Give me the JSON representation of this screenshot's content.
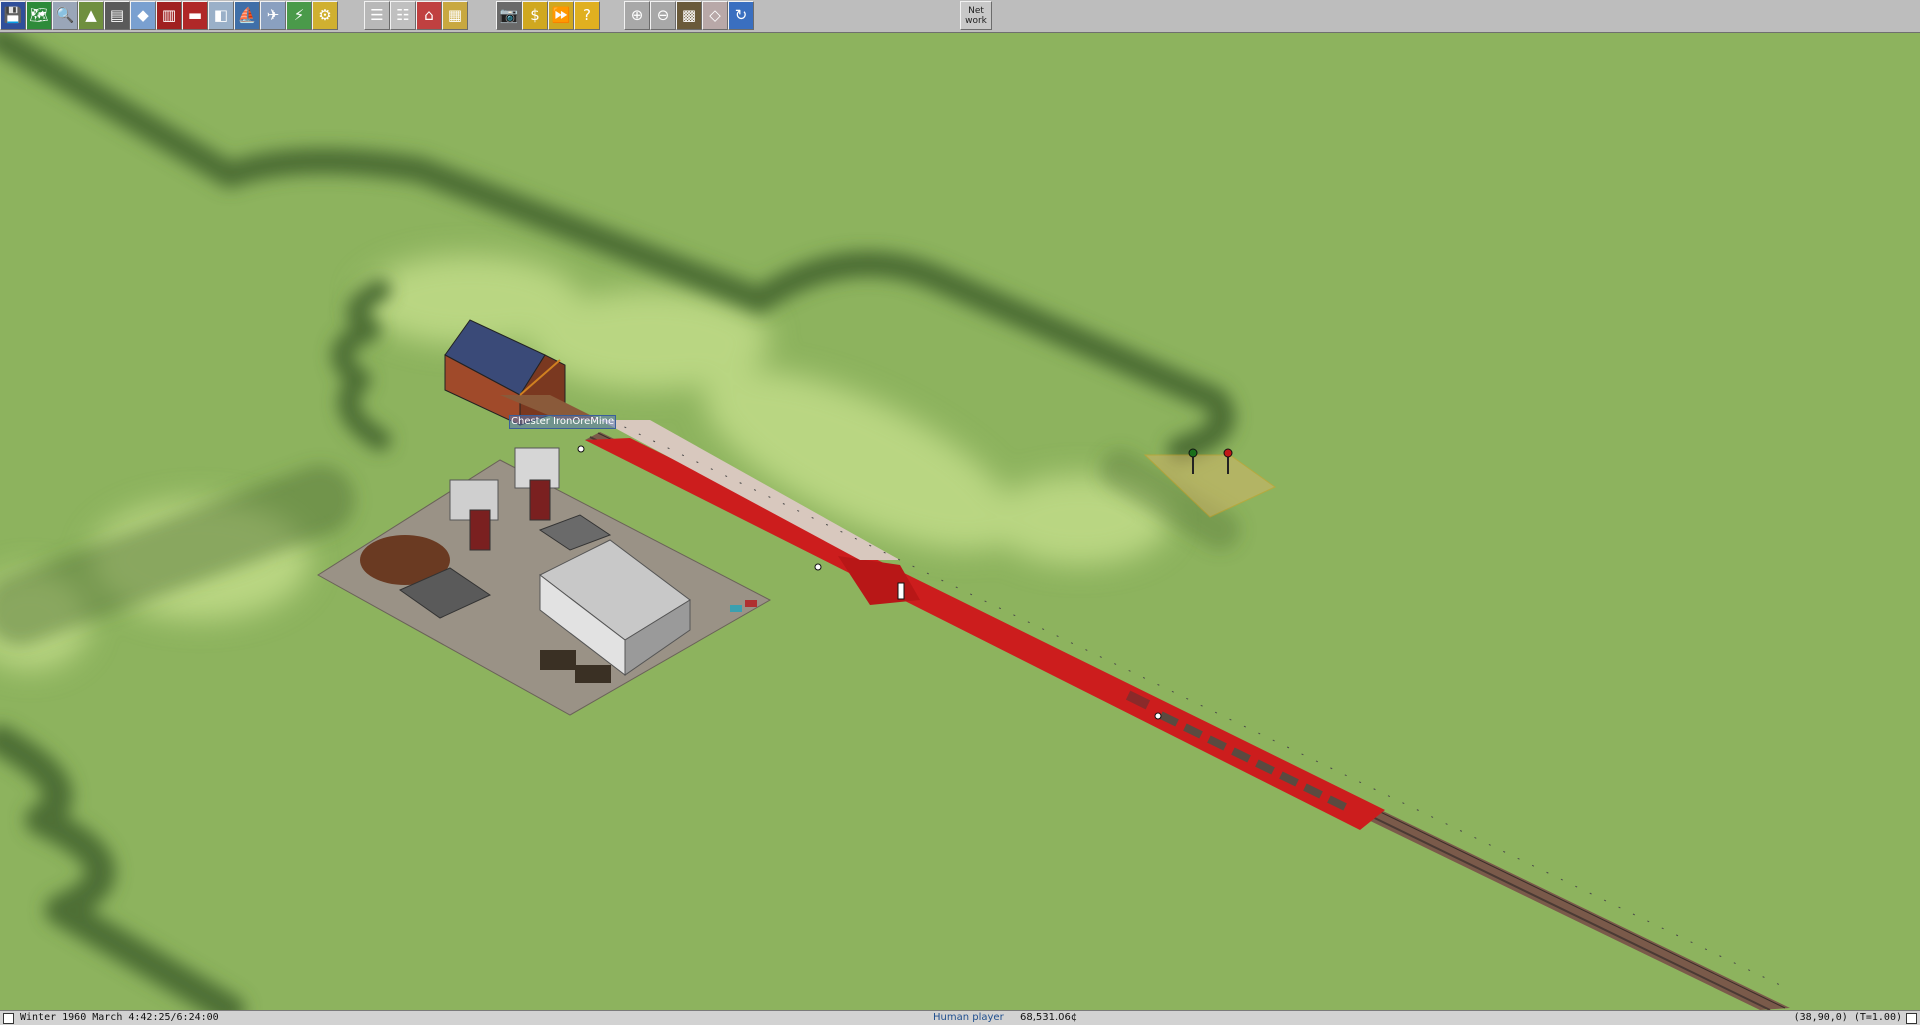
{
  "toolbar": {
    "buttons": [
      {
        "name": "save-icon",
        "glyph": "💾",
        "bg": "#2f4f9a"
      },
      {
        "name": "map-overview-icon",
        "glyph": "🗺",
        "bg": "#2e8b3a"
      },
      {
        "name": "magnifier-query-icon",
        "glyph": "🔍",
        "bg": "#9aa6b8"
      },
      {
        "name": "terrain-tools-icon",
        "glyph": "▲",
        "bg": "#6f8f3f"
      },
      {
        "name": "rail-tools-icon",
        "glyph": "▤",
        "bg": "#5a5a5a"
      },
      {
        "name": "monorail-tools-icon",
        "glyph": "◆",
        "bg": "#7aa0d0"
      },
      {
        "name": "tram-tools-icon",
        "glyph": "▥",
        "bg": "#a02020"
      },
      {
        "name": "road-vehicles-icon",
        "glyph": "▬",
        "bg": "#b02828"
      },
      {
        "name": "trucks-icon",
        "glyph": "◧",
        "bg": "#9ab0c8"
      },
      {
        "name": "ships-icon",
        "glyph": "⛵",
        "bg": "#3f6fa8"
      },
      {
        "name": "aircraft-icon",
        "glyph": "✈",
        "bg": "#8aa0c0"
      },
      {
        "name": "power-lines-icon",
        "glyph": "⚡",
        "bg": "#4a9a4a"
      },
      {
        "name": "special-tools-icon",
        "glyph": "⚙",
        "bg": "#d0b030"
      },
      {
        "name": "list-tool-icon",
        "glyph": "☰",
        "bg": "#b8b8b8"
      },
      {
        "name": "schedule-icon",
        "glyph": "☷",
        "bg": "#c0c0c0"
      },
      {
        "name": "depot-list-icon",
        "glyph": "⌂",
        "bg": "#c04040"
      },
      {
        "name": "halt-list-icon",
        "glyph": "▦",
        "bg": "#c8a840"
      },
      {
        "name": "screenshot-icon",
        "glyph": "📷",
        "bg": "#6a6a6a"
      },
      {
        "name": "finance-icon",
        "glyph": "$",
        "bg": "#d0a820"
      },
      {
        "name": "fast-forward-icon",
        "glyph": "⏩",
        "bg": "#d0a820"
      },
      {
        "name": "help-icon",
        "glyph": "?",
        "bg": "#e0b020"
      },
      {
        "name": "zoom-in-icon",
        "glyph": "⊕",
        "bg": "#a8a8a8"
      },
      {
        "name": "zoom-out-icon",
        "glyph": "⊖",
        "bg": "#a8a8a8"
      },
      {
        "name": "grid-toggle-icon",
        "glyph": "▩",
        "bg": "#6a5a3a"
      },
      {
        "name": "underground-view-icon",
        "glyph": "◇",
        "bg": "#b8a8a8"
      },
      {
        "name": "rotate-view-icon",
        "glyph": "↻",
        "bg": "#3a6fc0"
      }
    ],
    "network_label_line1": "Net",
    "network_label_line2": "work"
  },
  "map": {
    "factory_label": "Chester IronOreMine"
  },
  "status": {
    "date_time": "Winter 1960 March 4:42:25/6:24:00",
    "player": "Human player",
    "money": "68,531.06¢",
    "coords": "(38,90,0) (T=1.00)"
  }
}
